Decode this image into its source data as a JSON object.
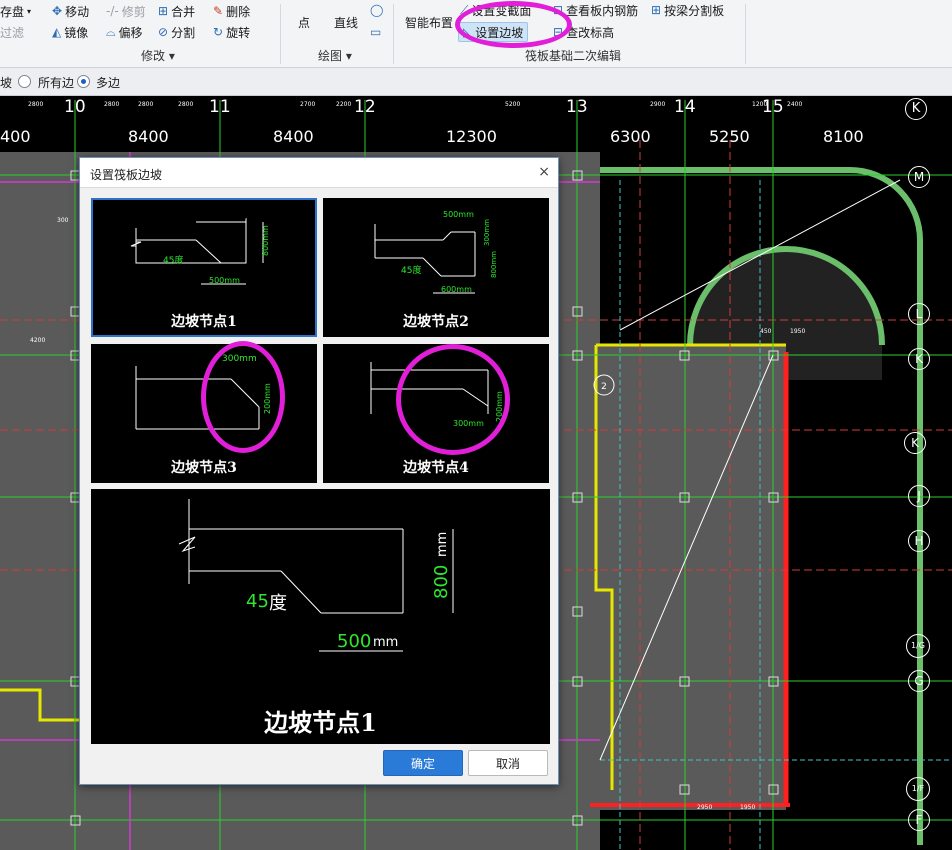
{
  "ribbon": {
    "row1": [
      "存盘",
      "移动",
      "修剪",
      "合并",
      "删除",
      "点",
      "直线",
      "设置变截面",
      "查看板内钢筋",
      "按梁分割板"
    ],
    "row2": [
      "过滤",
      "镜像",
      "偏移",
      "分割",
      "旋转",
      "智能布置",
      "设置边坡",
      "查改标高"
    ],
    "groups": {
      "modify": "修改",
      "draw": "绘图",
      "raft_edit": "筏板基础二次编辑"
    }
  },
  "optbar": {
    "prefix": "坡",
    "all_edges": "所有边",
    "multi_edges": "多边"
  },
  "axes": {
    "top_numbers": [
      "10",
      "11",
      "12",
      "13",
      "14",
      "15"
    ],
    "top_letter": "K",
    "spans": [
      "400",
      "8400",
      "8400",
      "12300",
      "6300",
      "5250",
      "8100"
    ],
    "right_letters": [
      "M",
      "L",
      "K",
      "J",
      "H",
      "G",
      "F"
    ],
    "right_letter_labels": [
      "M",
      "L",
      "K",
      "K",
      "J",
      "H",
      "1/G",
      "G",
      "1/F",
      "F"
    ],
    "small_dims": [
      "2800",
      "2800",
      "2800",
      "2800",
      "2700",
      "2200",
      "5200",
      "2900",
      "1200",
      "2400",
      "450",
      "1950",
      "4200",
      "300",
      "1950",
      "2950"
    ]
  },
  "dialog": {
    "title": "设置筏板边坡",
    "close": "×",
    "nodes": [
      {
        "caption": "边坡节点1",
        "angle": "45度",
        "h": "800mm",
        "w": "500mm"
      },
      {
        "caption": "边坡节点2",
        "angle": "45度",
        "h1": "300mm",
        "h2": "800mm",
        "w1": "500mm",
        "w2": "600mm"
      },
      {
        "caption": "边坡节点3",
        "w": "300mm",
        "h": "200mm"
      },
      {
        "caption": "边坡节点4",
        "w": "300mm",
        "h": "200mm"
      }
    ],
    "preview": {
      "caption": "边坡节点1",
      "angle_num": "45",
      "angle_unit": "度",
      "h_num": "800",
      "h_unit": "mm",
      "w_num": "500",
      "w_unit": "mm"
    },
    "ok": "确定",
    "cancel": "取消"
  },
  "colors": {
    "accent": "#2a7ad8",
    "annotation": "#e21fd8",
    "slab": "#5a5a5a",
    "cad_bg": "#000000"
  }
}
